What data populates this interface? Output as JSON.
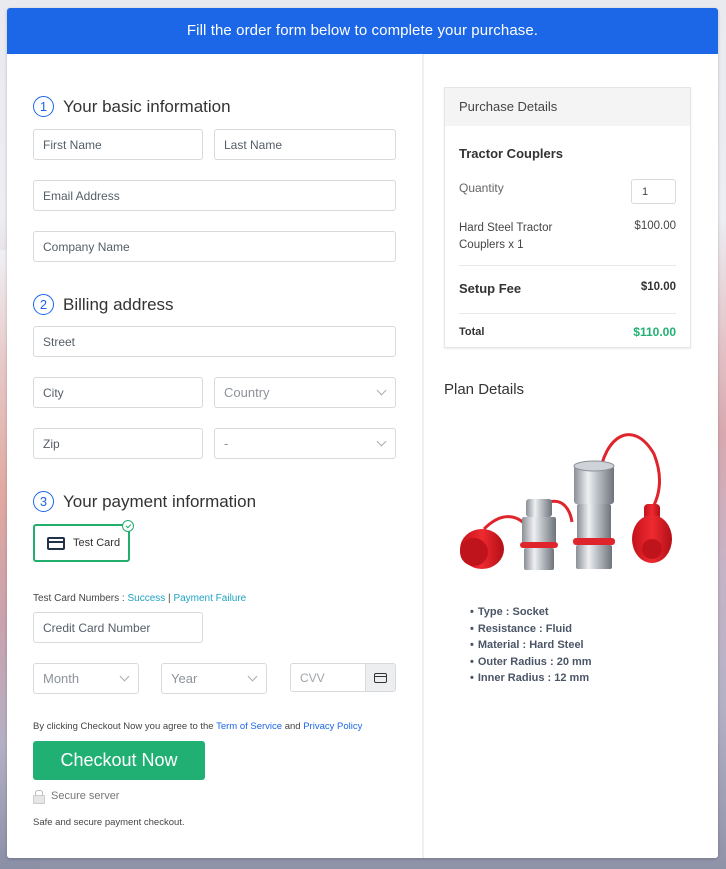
{
  "banner": {
    "text": "Fill the order form below to complete your purchase."
  },
  "sections": {
    "basic": {
      "number": "1",
      "title": "Your basic information"
    },
    "billing": {
      "number": "2",
      "title": "Billing address"
    },
    "payment": {
      "number": "3",
      "title": "Your payment information"
    }
  },
  "fields": {
    "first_name": {
      "placeholder": "First Name"
    },
    "last_name": {
      "placeholder": "Last Name"
    },
    "email": {
      "placeholder": "Email Address"
    },
    "company": {
      "placeholder": "Company Name"
    },
    "street": {
      "placeholder": "Street"
    },
    "city": {
      "placeholder": "City"
    },
    "country": {
      "value": "Country"
    },
    "zip": {
      "placeholder": "Zip"
    },
    "state": {
      "value": "-"
    },
    "card_number": {
      "placeholder": "Credit Card Number"
    },
    "month": {
      "value": "Month"
    },
    "year": {
      "value": "Year"
    },
    "cvv": {
      "placeholder": "CVV"
    }
  },
  "payment": {
    "method_label": "Test Card",
    "test_numbers_label": "Test Card Numbers : ",
    "success_link": "Success",
    "separator": " | ",
    "failure_link": "Payment Failure"
  },
  "terms": {
    "prefix": "By clicking Checkout Now you agree to the ",
    "tos_link": "Term of Service",
    "and": " and ",
    "privacy_link": "Privacy Policy"
  },
  "checkout": {
    "button_label": "Checkout Now",
    "secure_label": "Secure server",
    "safe_text": "Safe and secure payment checkout."
  },
  "purchase": {
    "header": "Purchase Details",
    "product_title": "Tractor Couplers",
    "quantity_label": "Quantity",
    "quantity_value": "1",
    "item_label": "Hard Steel Tractor Couplers x 1",
    "item_price": "$100.00",
    "setup_label": "Setup Fee",
    "setup_price": "$10.00",
    "total_label": "Total",
    "total_price": "$110.00"
  },
  "plan": {
    "title": "Plan Details",
    "features": [
      "Type : Socket",
      "Resistance : Fluid",
      "Material : Hard Steel",
      "Outer Radius : 20 mm",
      "Inner Radius : 12 mm"
    ]
  },
  "colors": {
    "banner": "#1b67e8",
    "accent_green": "#21b073",
    "link_teal": "#1fa3c3"
  }
}
